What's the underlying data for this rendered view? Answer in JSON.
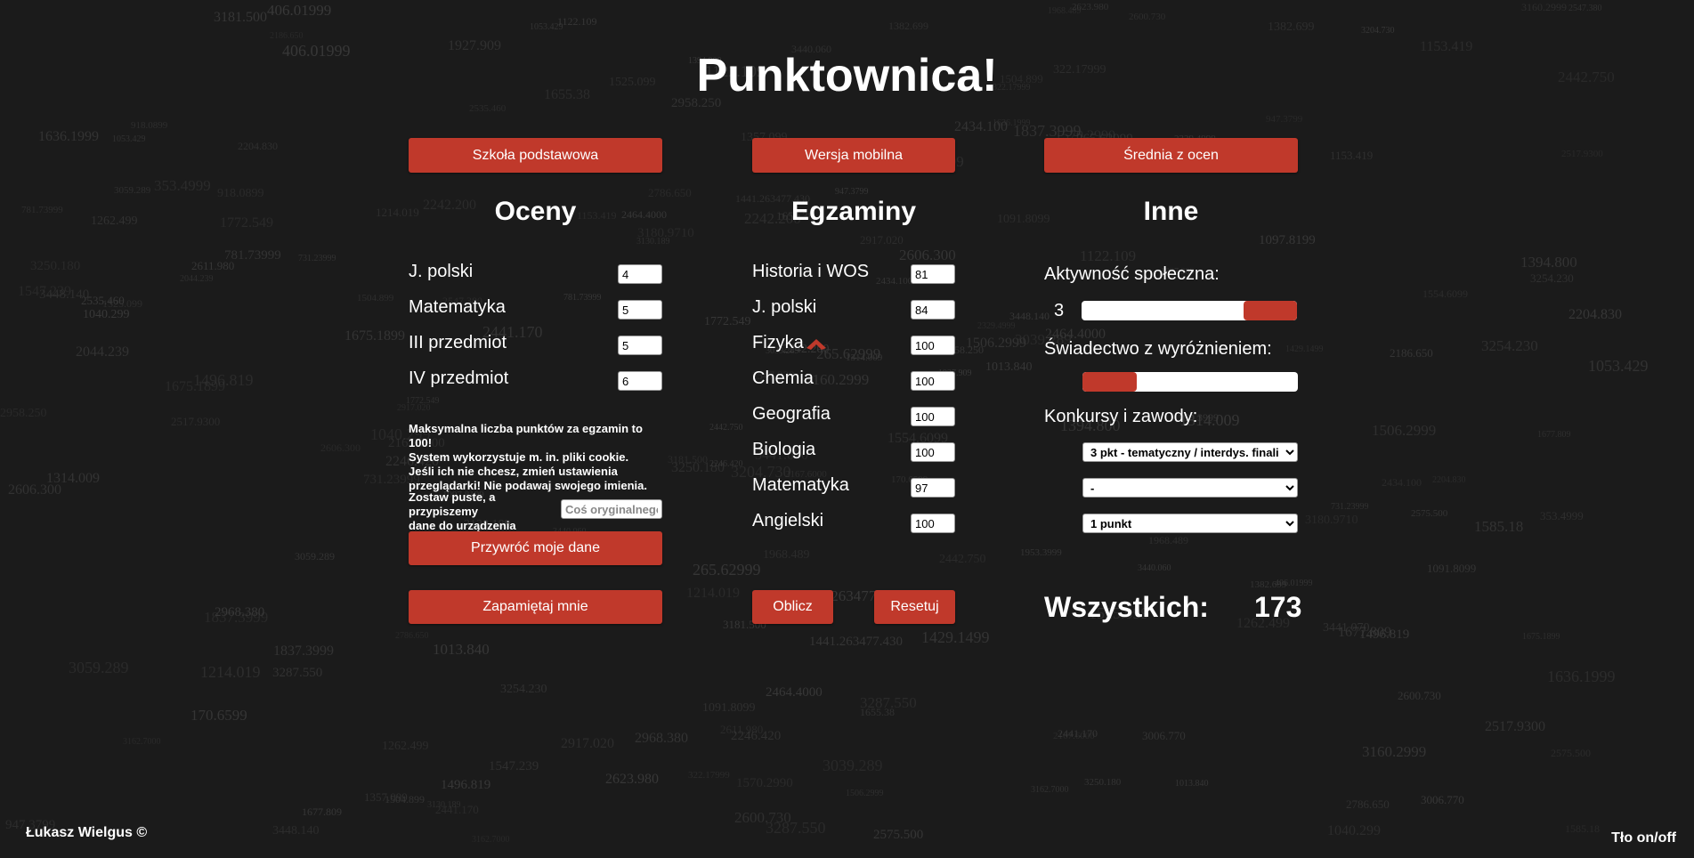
{
  "header": {
    "title": "Punktownica!"
  },
  "top_buttons": {
    "primary_school": "Szkoła podstawowa",
    "mobile_version": "Wersja mobilna",
    "grade_average": "Średnia z ocen"
  },
  "grades": {
    "heading": "Oceny",
    "items": [
      {
        "label": "J. polski",
        "value": "4"
      },
      {
        "label": "Matematyka",
        "value": "5"
      },
      {
        "label": "III przedmiot",
        "value": "5"
      },
      {
        "label": "IV przedmiot",
        "value": "6"
      }
    ],
    "note_lines": [
      "Maksymalna liczba punktów za egzamin to 100!",
      "System wykorzystuje m. in. pliki cookie.",
      "Jeśli ich nie chcesz, zmień ustawienia",
      "przeglądarki! Nie podawaj swojego imienia."
    ],
    "name_hint_lines": [
      "Zostaw puste, a przypiszemy",
      "dane do urządzenia"
    ],
    "name_placeholder": "Coś oryginalnego",
    "restore_button": "Przywróć moje dane",
    "remember_button": "Zapamiętaj mnie"
  },
  "exams": {
    "heading": "Egzaminy",
    "items": [
      {
        "label": "Historia i WOS",
        "value": "81"
      },
      {
        "label": "J. polski",
        "value": "84"
      },
      {
        "label": "Fizyka",
        "value": "100"
      },
      {
        "label": "Chemia",
        "value": "100"
      },
      {
        "label": "Geografia",
        "value": "100"
      },
      {
        "label": "Biologia",
        "value": "100"
      },
      {
        "label": "Matematyka",
        "value": "97"
      },
      {
        "label": "Angielski",
        "value": "100"
      }
    ],
    "calculate_button": "Oblicz",
    "reset_button": "Resetuj"
  },
  "other": {
    "heading": "Inne",
    "social_activity_label": "Aktywność społeczna:",
    "social_activity_value": "3",
    "social_activity_fraction": 0.75,
    "distinction_label": "Świadectwo z wyróżnieniem:",
    "distinction_fraction": 0.25,
    "contests_label": "Konkursy i zawody:",
    "contest_selects": [
      "3 pkt - tematyczny / interdys. finali",
      "-",
      "1 punkt"
    ]
  },
  "summary": {
    "total_label": "Wszystkich:",
    "total_value": "173"
  },
  "footer": {
    "author": "Łukasz Wielgus ©",
    "bg_toggle": "Tło on/off"
  },
  "colors": {
    "accent": "#c0392b",
    "background": "#1b1b1b",
    "bg_numbers": "#3a3a3a"
  },
  "background_numbers": [
    "2167.6000",
    "2442.750",
    "2958.250",
    "322.17999",
    "265.62999",
    "406.01999",
    "1496.819",
    "3250.180",
    "3448.140",
    "2434.100",
    "781.73999",
    "1262.499",
    "1506.2999",
    "918.0899",
    "2044.239",
    "3254.230",
    "1091.8099",
    "2242.200",
    "1013.840",
    "2517.9300",
    "1382.699",
    "1675.1899",
    "3130.189",
    "1927.909",
    "2246.420",
    "1214.019",
    "1636.1999",
    "2441.170",
    "2186.650",
    "3287.550",
    "3440.060",
    "1525.099",
    "947.3799",
    "1504.899",
    "3039.289",
    "3181.500",
    "1968.489",
    "3162.7000",
    "731.23999",
    "1772.549",
    "1314.009",
    "1394.800",
    "2600.730",
    "1441.263477.430",
    "2575.500",
    "1122.109",
    "2464.4000",
    "3160.2999",
    "1040.299",
    "1570.2990",
    "2606.300",
    "1677.809",
    "3059.289",
    "1547.239",
    "1153.419",
    "2204.830",
    "1655.38",
    "1053.429",
    "3204.730",
    "2786.650",
    "1837.3999",
    "2917.020",
    "1953.3999",
    "3006.770",
    "1429.1499",
    "2968.380",
    "2547.380",
    "1585.18",
    "1097.8199",
    "353.4999",
    "170.6599",
    "3441.070",
    "2329.4999",
    "2623.980",
    "2611.980",
    "1554.6099",
    "2535.460",
    "3180.9710",
    "1357.099"
  ]
}
